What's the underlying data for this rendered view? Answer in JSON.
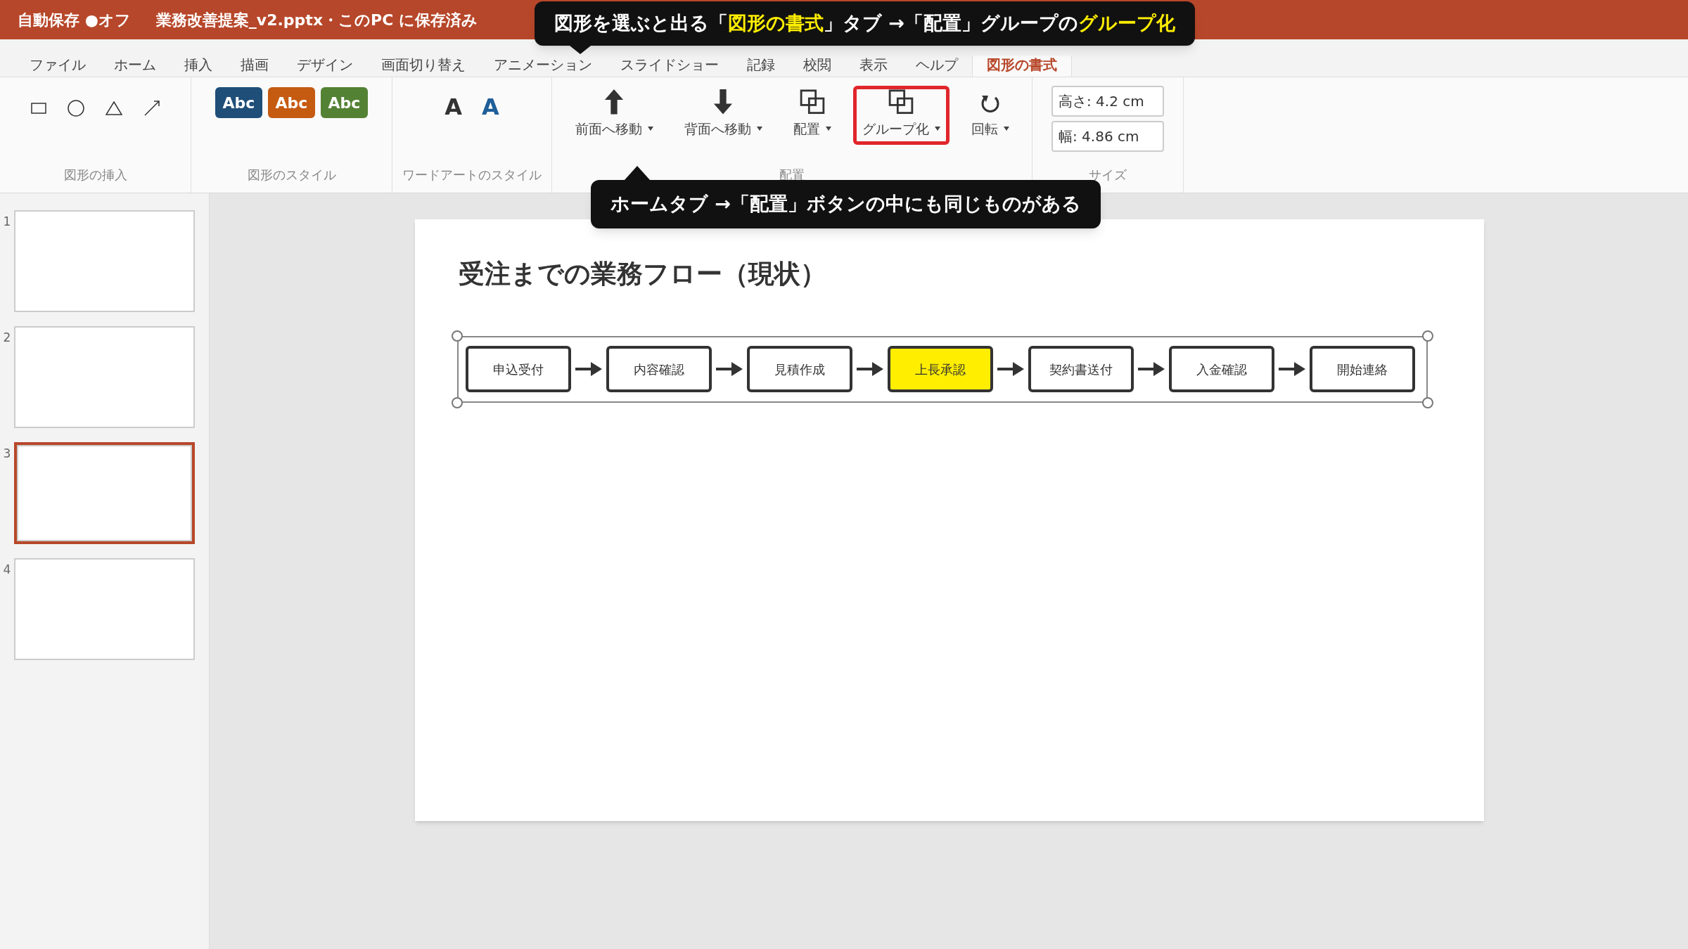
{
  "title_bar": {
    "autosave": "自動保存 ●オフ",
    "document": "業務改善提案_v2.pptx・このPC に保存済み"
  },
  "tabs": [
    {
      "label": "ファイル",
      "selected": false
    },
    {
      "label": "ホーム",
      "selected": false
    },
    {
      "label": "挿入",
      "selected": false
    },
    {
      "label": "描画",
      "selected": false
    },
    {
      "label": "デザイン",
      "selected": false
    },
    {
      "label": "画面切り替え",
      "selected": false
    },
    {
      "label": "アニメーション",
      "selected": false
    },
    {
      "label": "スライドショー",
      "selected": false
    },
    {
      "label": "記録",
      "selected": false
    },
    {
      "label": "校閲",
      "selected": false
    },
    {
      "label": "表示",
      "selected": false
    },
    {
      "label": "ヘルプ",
      "selected": false
    },
    {
      "label": "図形の書式",
      "selected": true
    }
  ],
  "shape_insert": {
    "label": "図形の挿入"
  },
  "shape_styles": {
    "label": "図形のスタイル",
    "swatches": [
      {
        "text": "Abc",
        "color": "#1f4e79"
      },
      {
        "text": "Abc",
        "color": "#c55a11"
      },
      {
        "text": "Abc",
        "color": "#548235"
      }
    ]
  },
  "wordart": {
    "label": "ワードアートのスタイル",
    "samples": [
      {
        "text": "A",
        "color": "#333333"
      },
      {
        "text": "A",
        "color": "#1f5f99"
      }
    ]
  },
  "arrange": {
    "label": "配置",
    "buttons": [
      {
        "label": "前面へ移動",
        "kind": "up",
        "highlighted": false
      },
      {
        "label": "背面へ移動",
        "kind": "down",
        "highlighted": false
      },
      {
        "label": "配置",
        "kind": "arrange",
        "highlighted": false
      },
      {
        "label": "グループ化",
        "kind": "group",
        "highlighted": true
      },
      {
        "label": "回転",
        "kind": "rotate",
        "highlighted": false
      }
    ]
  },
  "size": {
    "label": "サイズ",
    "fields": [
      {
        "value": "高さ: 4.2 cm"
      },
      {
        "value": "幅: 4.86 cm"
      }
    ]
  },
  "slides": [
    {
      "number": "1",
      "selected": false
    },
    {
      "number": "2",
      "selected": false
    },
    {
      "number": "3",
      "selected": true
    },
    {
      "number": "4",
      "selected": false
    }
  ],
  "slide": {
    "title": "受注までの業務フロー（現状）",
    "flow": [
      {
        "label": "申込受付",
        "highlighted": false
      },
      {
        "label": "内容確認",
        "highlighted": false
      },
      {
        "label": "見積作成",
        "highlighted": false
      },
      {
        "label": "上長承認",
        "highlighted": true
      },
      {
        "label": "契約書送付",
        "highlighted": false
      },
      {
        "label": "入金確認",
        "highlighted": false
      },
      {
        "label": "開始連絡",
        "highlighted": false
      }
    ]
  },
  "callouts": [
    {
      "segments": [
        {
          "text": "図形を選ぶと出る「",
          "highlight": false
        },
        {
          "text": "図形の書式",
          "highlight": true
        },
        {
          "text": "」タブ →「配置」グループの",
          "highlight": false
        },
        {
          "text": "グループ化",
          "highlight": true
        }
      ]
    },
    {
      "segments": [
        {
          "text": "ホームタブ →「配置」ボタンの中にも同じものがある",
          "highlight": false
        }
      ]
    }
  ]
}
